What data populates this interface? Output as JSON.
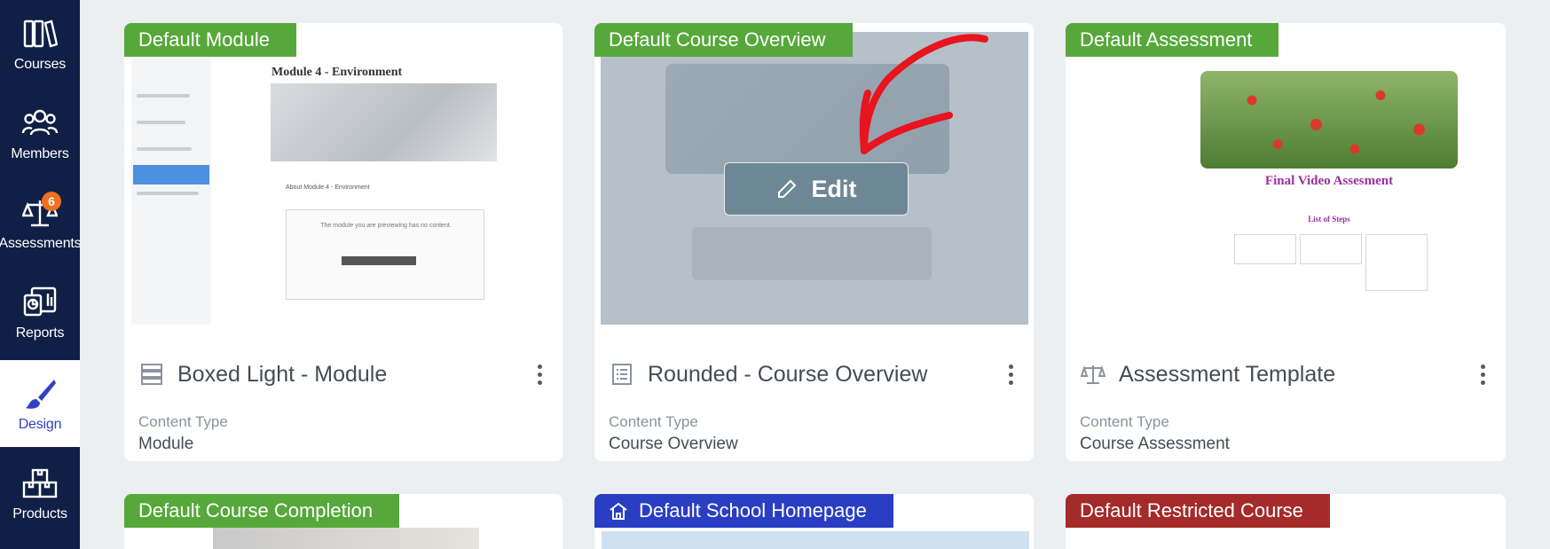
{
  "sidebar": {
    "items": [
      {
        "label": "Courses",
        "icon": "books-icon"
      },
      {
        "label": "Members",
        "icon": "users-icon"
      },
      {
        "label": "Assessments",
        "icon": "scale-icon",
        "badge": "6"
      },
      {
        "label": "Reports",
        "icon": "report-icon"
      },
      {
        "label": "Design",
        "icon": "paintbrush-icon",
        "active": true
      },
      {
        "label": "Products",
        "icon": "boxes-icon"
      }
    ]
  },
  "cards": [
    {
      "tag": "Default Module",
      "tag_color": "#56a83a",
      "title": "Boxed Light - Module",
      "content_type_label": "Content Type",
      "content_type": "Module",
      "thumb": {
        "heading": "Module 4 - Environment",
        "subheading": "About Module 4 - Environment",
        "message": "The module you are previewing has no content."
      }
    },
    {
      "tag": "Default Course Overview",
      "tag_color": "#56a83a",
      "title": "Rounded - Course Overview",
      "content_type_label": "Content Type",
      "content_type": "Course Overview",
      "edit_label": "Edit"
    },
    {
      "tag": "Default Assessment",
      "tag_color": "#56a83a",
      "title": "Assessment Template",
      "content_type_label": "Content Type",
      "content_type": "Course Assessment",
      "thumb": {
        "heading": "Final Video Assesment",
        "subheading": "List of Steps"
      }
    },
    {
      "tag": "Default Course Completion",
      "tag_color": "#56a83a"
    },
    {
      "tag": "Default School Homepage",
      "tag_color": "#2a3ec4"
    },
    {
      "tag": "Default Restricted Course",
      "tag_color": "#a52a2a"
    }
  ],
  "colors": {
    "sidebar": "#0f1f45",
    "active_nav": "#2f41c2",
    "badge": "#f07021",
    "annotation": "#e8141e"
  }
}
